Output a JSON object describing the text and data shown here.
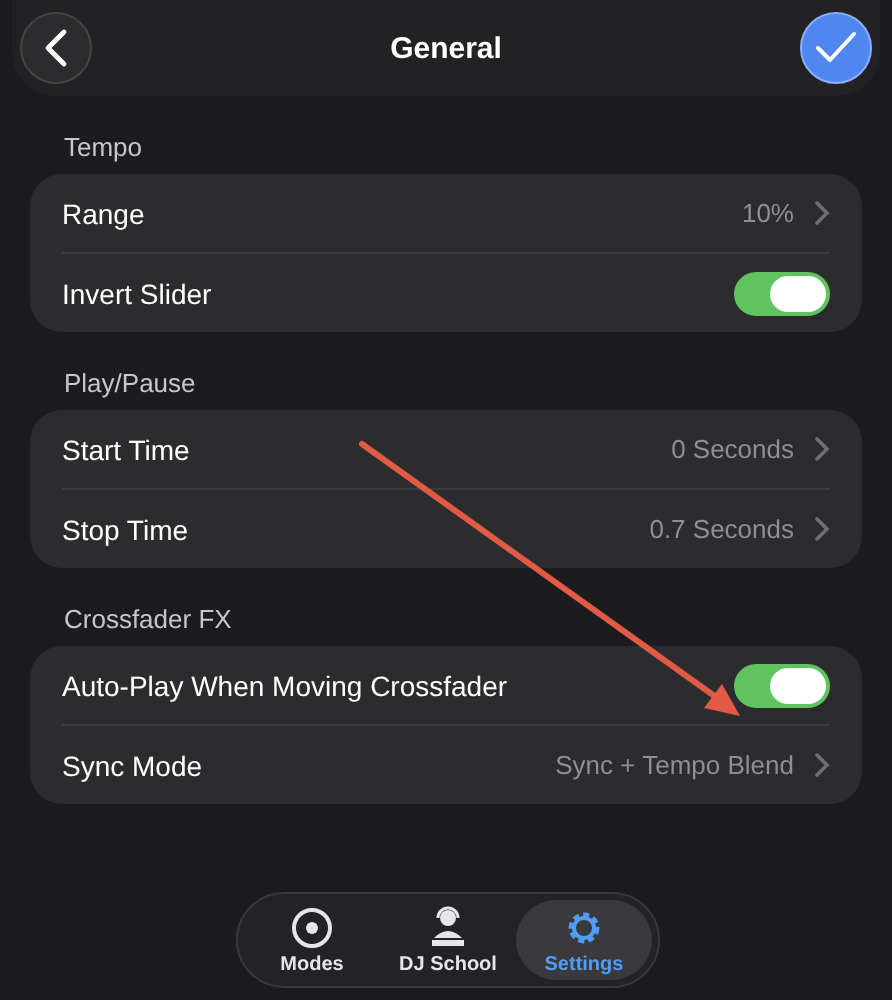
{
  "header": {
    "title": "General"
  },
  "sections": [
    {
      "title": "Tempo",
      "rows": [
        {
          "kind": "value",
          "label": "Range",
          "value": "10%"
        },
        {
          "kind": "toggle",
          "label": "Invert Slider",
          "on": true
        }
      ]
    },
    {
      "title": "Play/Pause",
      "rows": [
        {
          "kind": "value",
          "label": "Start Time",
          "value": "0 Seconds"
        },
        {
          "kind": "value",
          "label": "Stop Time",
          "value": "0.7 Seconds"
        }
      ]
    },
    {
      "title": "Crossfader FX",
      "rows": [
        {
          "kind": "toggle",
          "label": "Auto-Play When Moving Crossfader",
          "on": true
        },
        {
          "kind": "value",
          "label": "Sync Mode",
          "value": "Sync + Tempo Blend"
        }
      ]
    }
  ],
  "tabs": [
    {
      "kind": "modes",
      "label": "Modes",
      "selected": false
    },
    {
      "kind": "school",
      "label": "DJ School",
      "selected": false
    },
    {
      "kind": "settings",
      "label": "Settings",
      "selected": true
    }
  ]
}
